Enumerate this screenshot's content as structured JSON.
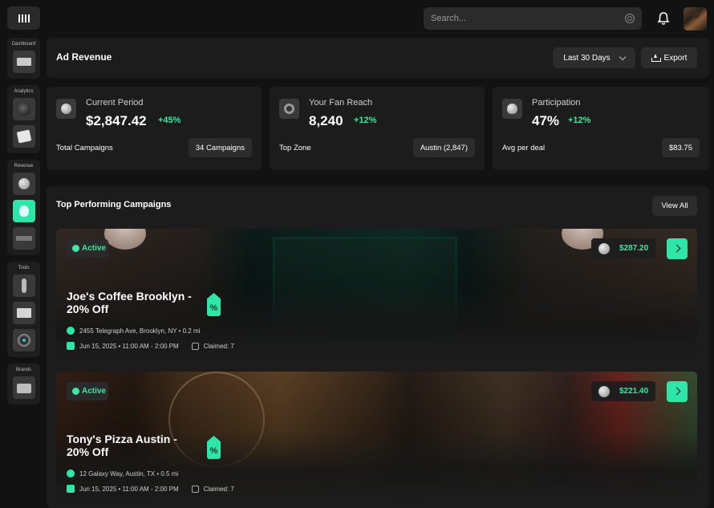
{
  "topbar": {
    "search_placeholder": "Search..."
  },
  "sidebar": {
    "groups": [
      {
        "title": "Dashboard",
        "items": [
          "keyboard-icon"
        ]
      },
      {
        "title": "Analytics",
        "items": [
          "globe-icon",
          "magic-cube-icon"
        ]
      },
      {
        "title": "Revenue",
        "items": [
          "coin-icon",
          "lightbulb-icon",
          "turntable-icon"
        ]
      },
      {
        "title": "Tools",
        "items": [
          "microphone-icon",
          "envelope-icon",
          "camera-lens-icon"
        ]
      },
      {
        "title": "Brands",
        "items": [
          "briefcase-icon"
        ]
      }
    ]
  },
  "header": {
    "title": "Ad Revenue",
    "range_label": "Last 30 Days",
    "export_label": "Export"
  },
  "stats": [
    {
      "label": "Current Period",
      "value": "$2,847.42",
      "delta": "+45%",
      "sub_label": "Total Campaigns",
      "sub_value": "34 Campaigns"
    },
    {
      "label": "Your Fan Reach",
      "value": "8,240",
      "delta": "+12%",
      "sub_label": "Top Zone",
      "sub_value": "Austin (2,847)"
    },
    {
      "label": "Participation",
      "value": "47%",
      "delta": "+12%",
      "sub_label": "Avg per deal",
      "sub_value": "$83.75"
    }
  ],
  "campaigns": {
    "title": "Top Performing Campaigns",
    "view_all": "View All",
    "items": [
      {
        "status": "Active",
        "price": "$287.20",
        "title": "Joe's Coffee Brooklyn - 20% Off",
        "tag": "%",
        "address": "2455 Telegraph Ave, Brooklyn, NY • 0.2 mi",
        "date": "Jun 15, 2025 • 11:00 AM - 2:00 PM",
        "claimed": "Claimed: 7"
      },
      {
        "status": "Active",
        "price": "$221.40",
        "title": "Tony's Pizza Austin - 20% Off",
        "tag": "%",
        "address": "12 Galaxy Way, Austin, TX • 0.5 mi",
        "date": "Jun 15, 2025 • 11:00 AM - 2:00 PM",
        "claimed": "Claimed: 7"
      }
    ]
  },
  "colors": {
    "accent": "#2ee6a8",
    "positive": "#3fe5a0",
    "background": "#121212",
    "panel": "#1c1c1c"
  }
}
